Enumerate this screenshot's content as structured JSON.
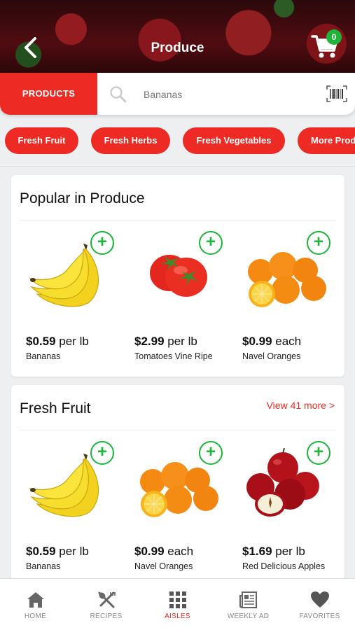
{
  "header": {
    "title": "Produce",
    "cart_count": "0"
  },
  "search": {
    "tab_label": "PRODUCTS",
    "value": "Bananas"
  },
  "chips": [
    "Fresh Fruit",
    "Fresh Herbs",
    "Fresh Vegetables",
    "More Products"
  ],
  "popular": {
    "title": "Popular in Produce",
    "products": [
      {
        "price": "$0.59",
        "unit": " per lb",
        "name": "Bananas",
        "icon": "banana-image"
      },
      {
        "price": "$2.99",
        "unit": " per lb",
        "name": "Tomatoes Vine Ripe",
        "icon": "tomato-image"
      },
      {
        "price": "$0.99",
        "unit": " each",
        "name": "Navel Oranges",
        "icon": "orange-image"
      }
    ]
  },
  "fresh_fruit": {
    "title": "Fresh Fruit",
    "view_more": "View 41 more >",
    "products": [
      {
        "price": "$0.59",
        "unit": " per lb",
        "name": "Bananas",
        "icon": "banana-image"
      },
      {
        "price": "$0.99",
        "unit": " each",
        "name": "Navel Oranges",
        "icon": "orange-image"
      },
      {
        "price": "$1.69",
        "unit": " per lb",
        "name": "Red Delicious Apples",
        "icon": "apple-image"
      }
    ]
  },
  "nav": [
    {
      "label": "HOME",
      "icon": "home-icon"
    },
    {
      "label": "RECIPES",
      "icon": "recipes-icon"
    },
    {
      "label": "AISLES",
      "icon": "aisles-icon",
      "active": true
    },
    {
      "label": "WEEKLY AD",
      "icon": "weekly-ad-icon"
    },
    {
      "label": "FAVORITES",
      "icon": "favorites-icon"
    }
  ],
  "colors": {
    "accent": "#ee2a24",
    "add": "#1db43a"
  }
}
